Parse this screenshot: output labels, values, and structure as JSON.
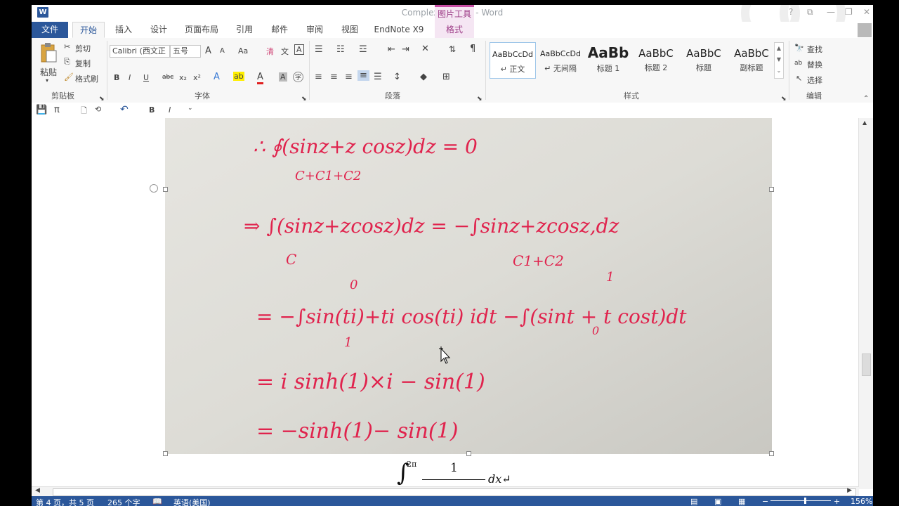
{
  "window": {
    "title": "Complexfunction - Word",
    "context_group": "图片工具",
    "help": "?",
    "ribbon_display": "⧉",
    "minimize": "—",
    "restore": "❐",
    "close": "✕"
  },
  "tabs": [
    {
      "label": "文件"
    },
    {
      "label": "开始"
    },
    {
      "label": "插入"
    },
    {
      "label": "设计"
    },
    {
      "label": "页面布局"
    },
    {
      "label": "引用"
    },
    {
      "label": "邮件"
    },
    {
      "label": "审阅"
    },
    {
      "label": "视图"
    },
    {
      "label": "EndNote X9"
    },
    {
      "label": "格式"
    }
  ],
  "clipboard": {
    "paste": "粘贴",
    "cut": "剪切",
    "copy": "复制",
    "format_painter": "格式刷",
    "group": "剪贴板"
  },
  "font": {
    "name": "Calibri (西文正",
    "size": "五号",
    "group": "字体",
    "case": "Aa",
    "clear": "清",
    "phonetic": "文",
    "charborder": "A",
    "bold": "B",
    "italic": "I",
    "underline": "U",
    "strike": "abc",
    "sub": "x₂",
    "sup": "x²",
    "effects": "A",
    "highlight": "ab",
    "color": "A",
    "shade": "A",
    "enclose": "字",
    "grow": "A",
    "shrink": "A"
  },
  "paragraph": {
    "group": "段落"
  },
  "styles": {
    "group": "样式",
    "items": [
      {
        "preview": "AaBbCcDd",
        "name": "↵ 正文"
      },
      {
        "preview": "AaBbCcDd",
        "name": "↵ 无间隔"
      },
      {
        "preview": "AaBb",
        "name": "标题 1"
      },
      {
        "preview": "AaBbC",
        "name": "标题 2"
      },
      {
        "preview": "AaBbC",
        "name": "标题"
      },
      {
        "preview": "AaBbC",
        "name": "副标题"
      }
    ]
  },
  "editing": {
    "find": "查找",
    "replace": "替换",
    "select": "选择",
    "group": "编辑"
  },
  "qat": {
    "pi": "π",
    "bold": "B",
    "italic": "I"
  },
  "document": {
    "handwriting": [
      "∴ ∮(sinz+z cosz)dz = 0",
      "C+C1+C2",
      "⇒ ∫(sinz+zcosz)dz = −∫sinz+zcosz,dz",
      "C",
      "C1+C2",
      "0",
      "= −∫sin(ti)+ti cos(ti) idt −∫(sint + t cost)dt",
      "1",
      "1",
      "0",
      "= i sinh(1)×i − sin(1)",
      "= −sinh(1)− sin(1)"
    ],
    "below_formula": {
      "upper": "2π",
      "numerator": "1",
      "dx": "dx↵"
    }
  },
  "status": {
    "page": "第 4 页，共 5 页",
    "words": "265 个字",
    "lang": "英语(美国)",
    "zoom": "156%"
  },
  "colors": {
    "accent": "#2b579a",
    "context": "#c74da4",
    "ink": "#e0234d"
  }
}
